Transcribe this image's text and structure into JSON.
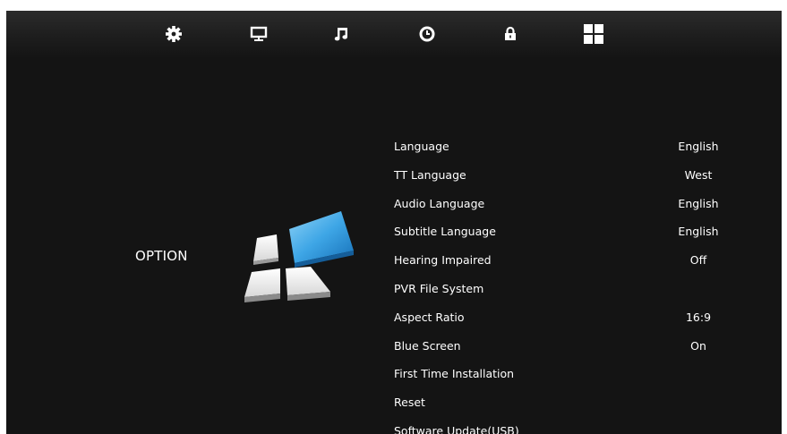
{
  "tabs": [
    {
      "name": "picture-tab",
      "icon": "gear-icon"
    },
    {
      "name": "screen-tab",
      "icon": "monitor-icon"
    },
    {
      "name": "sound-tab",
      "icon": "music-note-icon"
    },
    {
      "name": "time-tab",
      "icon": "clock-icon"
    },
    {
      "name": "lock-tab",
      "icon": "lock-icon"
    },
    {
      "name": "option-tab",
      "icon": "grid-icon",
      "selected": true
    }
  ],
  "page": {
    "title": "OPTION",
    "icon": "option-logo-icon"
  },
  "menu": {
    "items": [
      {
        "label": "Language",
        "value": "English"
      },
      {
        "label": "TT Language",
        "value": "West"
      },
      {
        "label": "Audio Language",
        "value": "English"
      },
      {
        "label": "Subtitle Language",
        "value": "English"
      },
      {
        "label": "Hearing Impaired",
        "value": "Off"
      },
      {
        "label": "PVR File System",
        "value": ""
      },
      {
        "label": "Aspect Ratio",
        "value": "16:9"
      },
      {
        "label": "Blue Screen",
        "value": "On"
      },
      {
        "label": "First Time Installation",
        "value": ""
      },
      {
        "label": "Reset",
        "value": ""
      },
      {
        "label": "Software Update(USB)",
        "value": ""
      }
    ]
  },
  "colors": {
    "background": "#141414",
    "text": "#ffffff",
    "accent": "#3ea6e6"
  }
}
